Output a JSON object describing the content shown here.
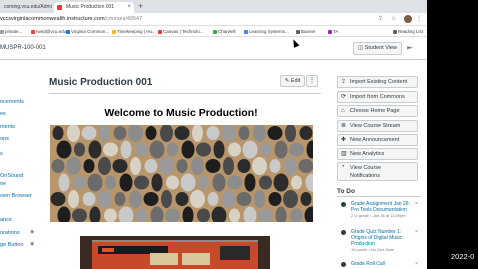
{
  "browser": {
    "tabs": [
      {
        "label": "coming.vcu.edu/Admi"
      },
      {
        "label": "Music Production 001",
        "active": true
      }
    ],
    "new_tab": "+",
    "url_host": "vccsvirginiacommonwealth.instructure.com",
    "url_path": "/courses/49547",
    "bookmarks": [
      {
        "label": "private...",
        "color": "#9aa0a6"
      },
      {
        "label": "rwed@vcu.edu",
        "color": "#ea4335"
      },
      {
        "label": "Virginia Common...",
        "color": "#1a73e8"
      },
      {
        "label": "Timekeeping | Hu...",
        "color": "#fbbc04"
      },
      {
        "label": "Canvas | Technolo...",
        "color": "#e13c2c"
      },
      {
        "label": "Charwell",
        "color": "#34a853"
      },
      {
        "label": "Learning Systems...",
        "color": "#4285f4"
      },
      {
        "label": "Banner",
        "color": "#5f6368"
      },
      {
        "label": "TA",
        "color": "#9c27b0"
      },
      {
        "label": "Reading List",
        "color": "#5f6368"
      }
    ]
  },
  "course": {
    "code": "MUSPR-100-001",
    "student_view_label": "Student View",
    "collapse_icon": "collapse-sidebar-icon"
  },
  "nav": [
    "ncements",
    "es",
    "ments",
    "ons",
    "s",
    "OnSound",
    "ne",
    "own Browser",
    "ance",
    "orations",
    "ge Button"
  ],
  "main": {
    "title": "Music Production 001",
    "edit_label": "Edit",
    "more_label": "⋮",
    "welcome": "Welcome to Music Production!"
  },
  "sidebar": {
    "buttons": [
      {
        "label": "Import Existing Content",
        "icon": "import-icon"
      },
      {
        "label": "Import from Commons",
        "icon": "commons-icon"
      },
      {
        "label": "Choose Home Page",
        "icon": "home-icon"
      },
      {
        "label": "View Course Stream",
        "icon": "stream-icon"
      },
      {
        "label": "New Announcement",
        "icon": "announcement-icon"
      },
      {
        "label": "New Analytics",
        "icon": "analytics-icon"
      },
      {
        "label": "View Course",
        "label2": "Notifications",
        "icon": "bell-icon"
      }
    ],
    "todo_title": "To Do",
    "todos": [
      {
        "title": "Grade Assignment Jan 26: Pro Tools Documentation",
        "meta": "2 to grade • Jan 28 at 11:59pm"
      },
      {
        "title": "Grade Quiz Number 1: Origins of Digital Music Production",
        "meta": "15 points • No Due Date"
      },
      {
        "title": "Grade Roll Call",
        "meta": ""
      }
    ]
  },
  "clock": "2022-0"
}
